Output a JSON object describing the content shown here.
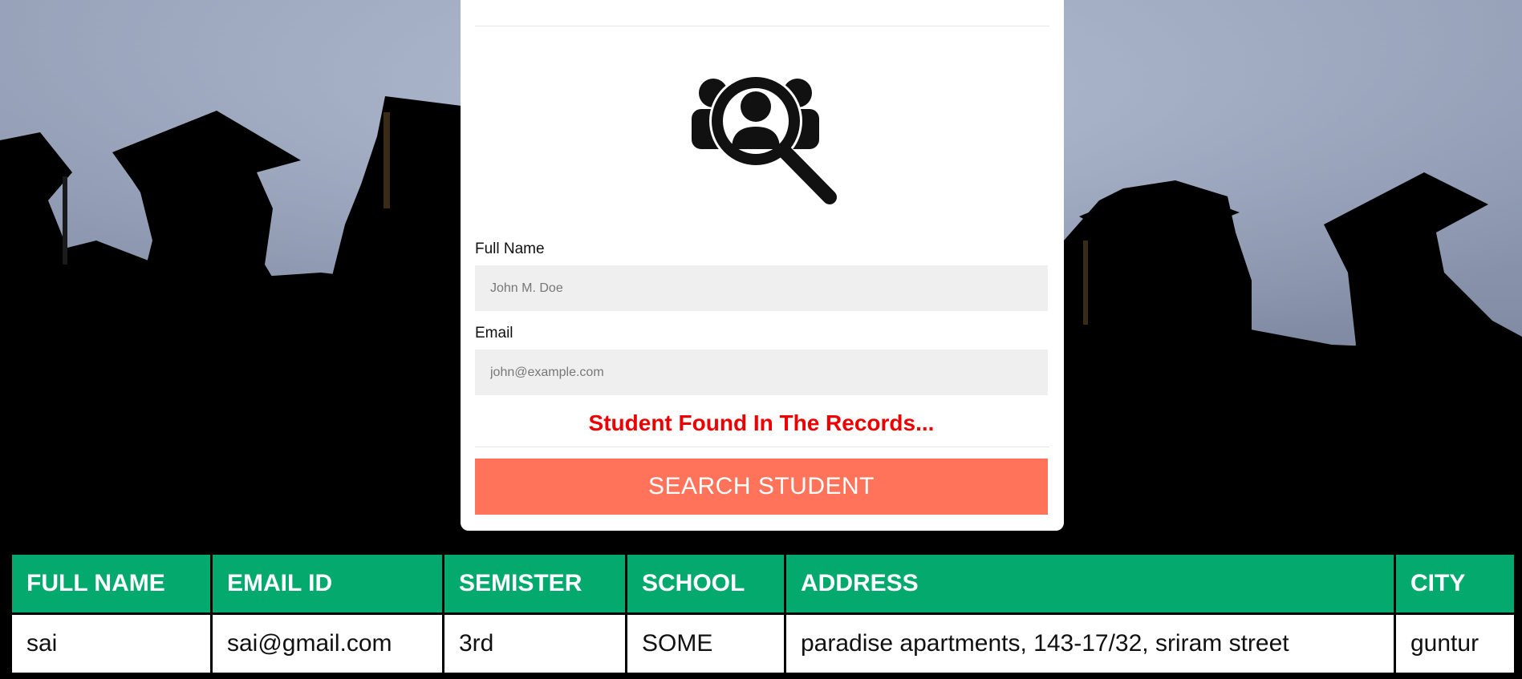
{
  "form": {
    "full_name_label": "Full Name",
    "full_name_placeholder": "John M. Doe",
    "email_label": "Email",
    "email_placeholder": "john@example.com",
    "status_message": "Student Found In The Records...",
    "search_button_label": "SEARCH STUDENT",
    "hero_icon": "student-search-icon"
  },
  "table": {
    "headers": [
      "FULL NAME",
      "EMAIL ID",
      "SEMISTER",
      "SCHOOL",
      "ADDRESS",
      "CITY"
    ],
    "rows": [
      [
        "sai",
        "sai@gmail.com",
        "3rd",
        "SOME",
        "paradise apartments, 143-17/32, sriram street",
        "guntur"
      ]
    ]
  },
  "colors": {
    "header_bg": "#04aa6d",
    "button_bg": "#ff735b",
    "status_text": "#ee0000"
  }
}
